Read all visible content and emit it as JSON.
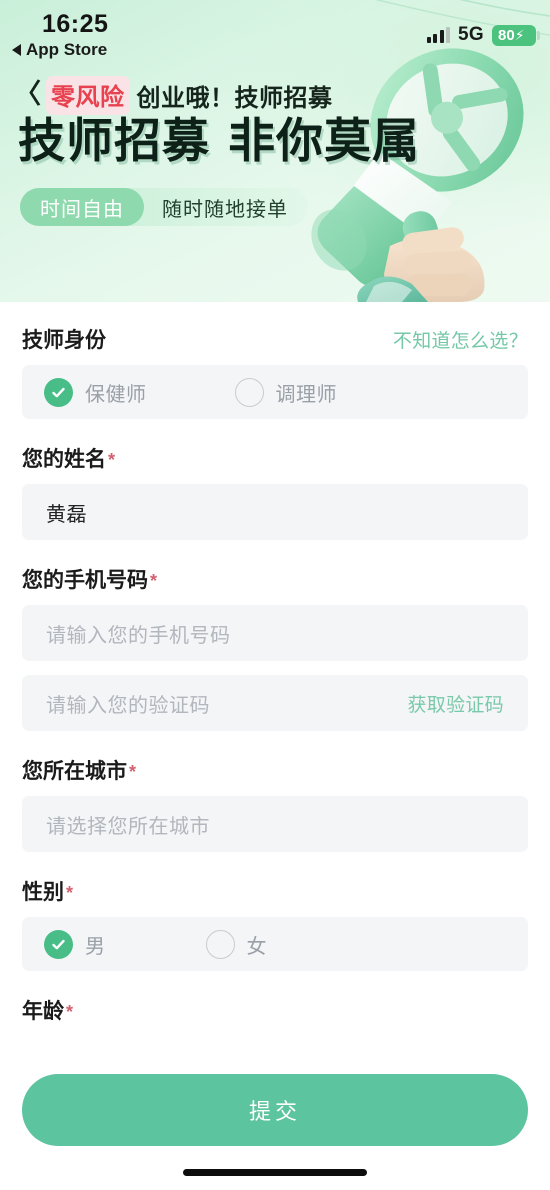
{
  "status_bar": {
    "time": "16:25",
    "return_app": "App Store",
    "network": "5G",
    "battery": "80",
    "charging_glyph": "⚡"
  },
  "nav": {
    "back_glyph": "〈",
    "badge": "零风险",
    "rest": "创业哦！技师招募"
  },
  "banner": {
    "headline_left": "技师招募",
    "headline_right": "非你莫属",
    "tags": [
      {
        "label": "时间自由",
        "style": "solid"
      },
      {
        "label": "随时随地接单",
        "style": "light"
      }
    ],
    "illustration": "megaphone-in-hand"
  },
  "form": {
    "identity": {
      "label": "技师身份",
      "help_link": "不知道怎么选？",
      "options": [
        {
          "label": "保健师",
          "selected": true
        },
        {
          "label": "调理师",
          "selected": false
        }
      ]
    },
    "name": {
      "label": "您的姓名",
      "required": "*",
      "value": "黄磊"
    },
    "phone": {
      "label": "您的手机号码",
      "required": "*",
      "placeholder": "请输入您的手机号码",
      "code_placeholder": "请输入您的验证码",
      "code_button": "获取验证码"
    },
    "city": {
      "label": "您所在城市",
      "required": "*",
      "placeholder": "请选择您所在城市"
    },
    "gender": {
      "label": "性别",
      "required": "*",
      "options": [
        {
          "label": "男",
          "selected": true
        },
        {
          "label": "女",
          "selected": false
        }
      ]
    },
    "age": {
      "label": "年龄",
      "required": "*"
    }
  },
  "submit_button": "提交",
  "colors": {
    "accent_green": "#5cc49e",
    "radio_green": "#48bd87",
    "link_green": "#74c8a8",
    "required_red": "#d0616f",
    "badge_red": "#e8414f",
    "banner_green": "#d8f4e3"
  }
}
